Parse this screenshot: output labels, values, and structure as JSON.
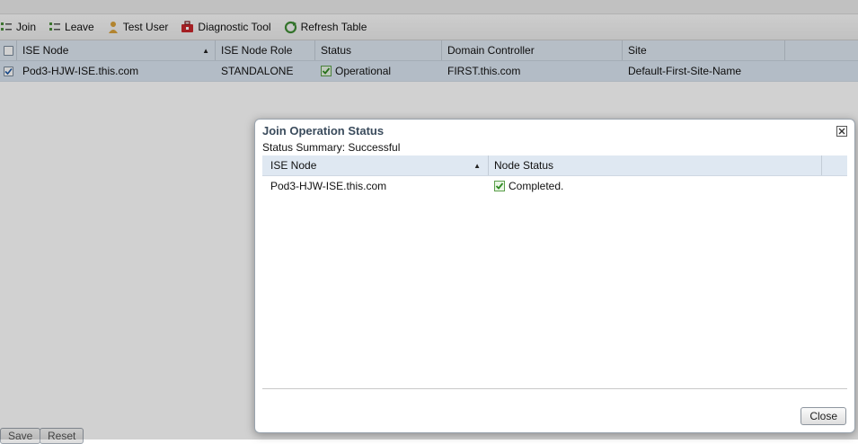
{
  "toolbar": {
    "join": "Join",
    "leave": "Leave",
    "test_user": "Test User",
    "diagnostic_tool": "Diagnostic Tool",
    "refresh_table": "Refresh Table"
  },
  "table": {
    "headers": [
      "ISE Node",
      "ISE Node Role",
      "Status",
      "Domain Controller",
      "Site"
    ],
    "rows": [
      {
        "ise_node": "Pod3-HJW-ISE.this.com",
        "role": "STANDALONE",
        "status": "Operational",
        "domain_controller": "FIRST.this.com",
        "site": "Default-First-Site-Name"
      }
    ]
  },
  "footer": {
    "save": "Save",
    "reset": "Reset"
  },
  "dialog": {
    "title": "Join Operation Status",
    "summary": "Status Summary: Successful",
    "headers": [
      "ISE Node",
      "Node Status"
    ],
    "rows": [
      {
        "ise_node": "Pod3-HJW-ISE.this.com",
        "node_status": "Completed."
      }
    ],
    "close_button": "Close"
  },
  "colors": {
    "accent": "#3a4b5c",
    "header_bg": "#dfe8f2",
    "ok_green": "#3aa02c"
  },
  "icons": [
    "join-icon",
    "leave-icon",
    "test-user-icon",
    "diagnostic-tool-icon",
    "refresh-table-icon",
    "check-ok-icon",
    "close-icon",
    "sort-ascending-icon"
  ]
}
